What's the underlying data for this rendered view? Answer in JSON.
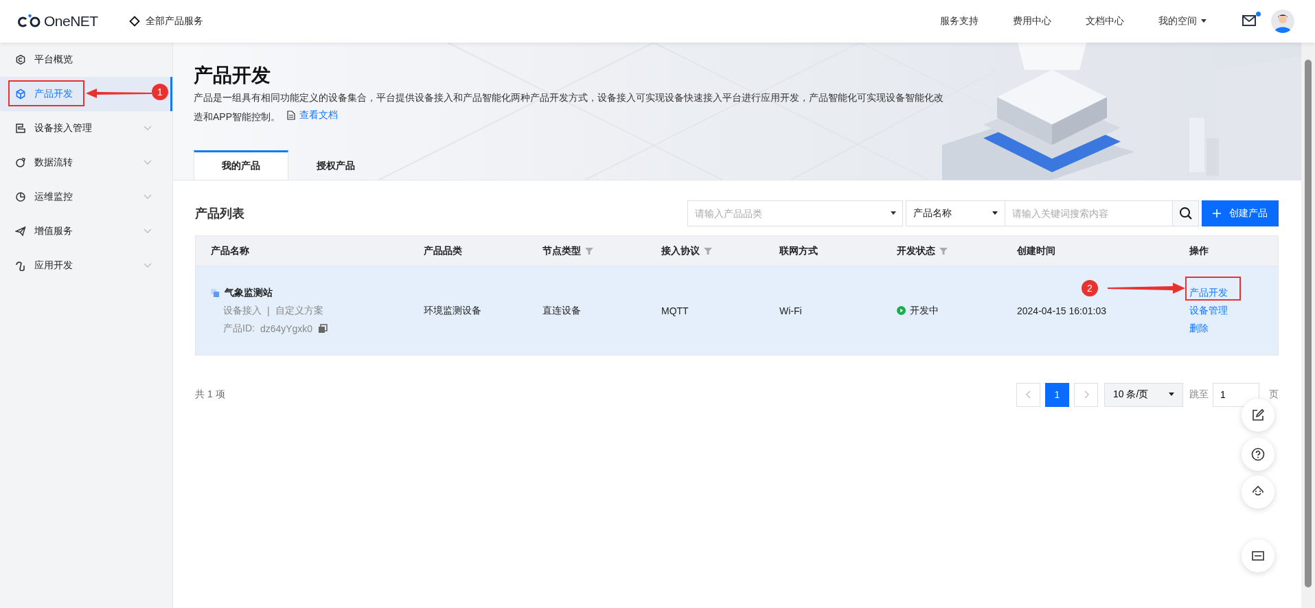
{
  "top_bar": {
    "logo": "OneNET",
    "all_services": "全部产品服务",
    "links": [
      "服务支持",
      "费用中心",
      "文档中心"
    ],
    "my_space": "我的空间",
    "mail_unread": true
  },
  "sidebar": {
    "items": [
      {
        "label": "平台概览",
        "selected": false,
        "expandable": false
      },
      {
        "label": "产品开发",
        "selected": true,
        "expandable": false
      },
      {
        "label": "设备接入管理",
        "selected": false,
        "expandable": true
      },
      {
        "label": "数据流转",
        "selected": false,
        "expandable": true
      },
      {
        "label": "运维监控",
        "selected": false,
        "expandable": true
      },
      {
        "label": "增值服务",
        "selected": false,
        "expandable": true
      },
      {
        "label": "应用开发",
        "selected": false,
        "expandable": true
      }
    ]
  },
  "page": {
    "title": "产品开发",
    "description": "产品是一组具有相同功能定义的设备集合，平台提供设备接入和产品智能化两种产品开发方式，设备接入可实现设备快速接入平台进行应用开发，产品智能化可实现设备智能化改造和APP智能控制。",
    "doc_link": "查看文档"
  },
  "tabs": [
    {
      "label": "我的产品",
      "selected": true
    },
    {
      "label": "授权产品",
      "selected": false
    }
  ],
  "product_list": {
    "title": "产品列表",
    "category_filter": {
      "placeholder": "请输入产品品类"
    },
    "search_by": "产品名称",
    "search": {
      "placeholder": "请输入关键词搜索内容"
    },
    "create_button": "创建产品"
  },
  "table": {
    "columns": [
      {
        "label": "产品名称",
        "filter": false
      },
      {
        "label": "产品品类",
        "filter": false
      },
      {
        "label": "节点类型",
        "filter": true
      },
      {
        "label": "接入协议",
        "filter": true
      },
      {
        "label": "联网方式",
        "filter": false
      },
      {
        "label": "开发状态",
        "filter": true
      },
      {
        "label": "创建时间",
        "filter": false
      },
      {
        "label": "操作",
        "filter": false
      }
    ],
    "rows": [
      {
        "selected": true,
        "name": "气象监测站",
        "access": "设备接入",
        "separator": "|",
        "scheme": "自定义方案",
        "id_label": "产品ID:",
        "id": "dz64yYgxk0",
        "category": "环境监测设备",
        "node_type": "直连设备",
        "protocol": "MQTT",
        "network": "Wi-Fi",
        "status": "开发中",
        "created": "2024-04-15 16:01:03",
        "actions": [
          "产品开发",
          "设备管理",
          "删除"
        ]
      }
    ]
  },
  "footer": {
    "total": "共 1 项",
    "pages": [
      {
        "label": "1",
        "selected": true
      }
    ],
    "page_size": "10 条/页",
    "jump_label": "跳至",
    "jump_value": "1",
    "page_suffix": "页"
  },
  "annotations": [
    {
      "number": "1"
    },
    {
      "number": "2"
    }
  ]
}
